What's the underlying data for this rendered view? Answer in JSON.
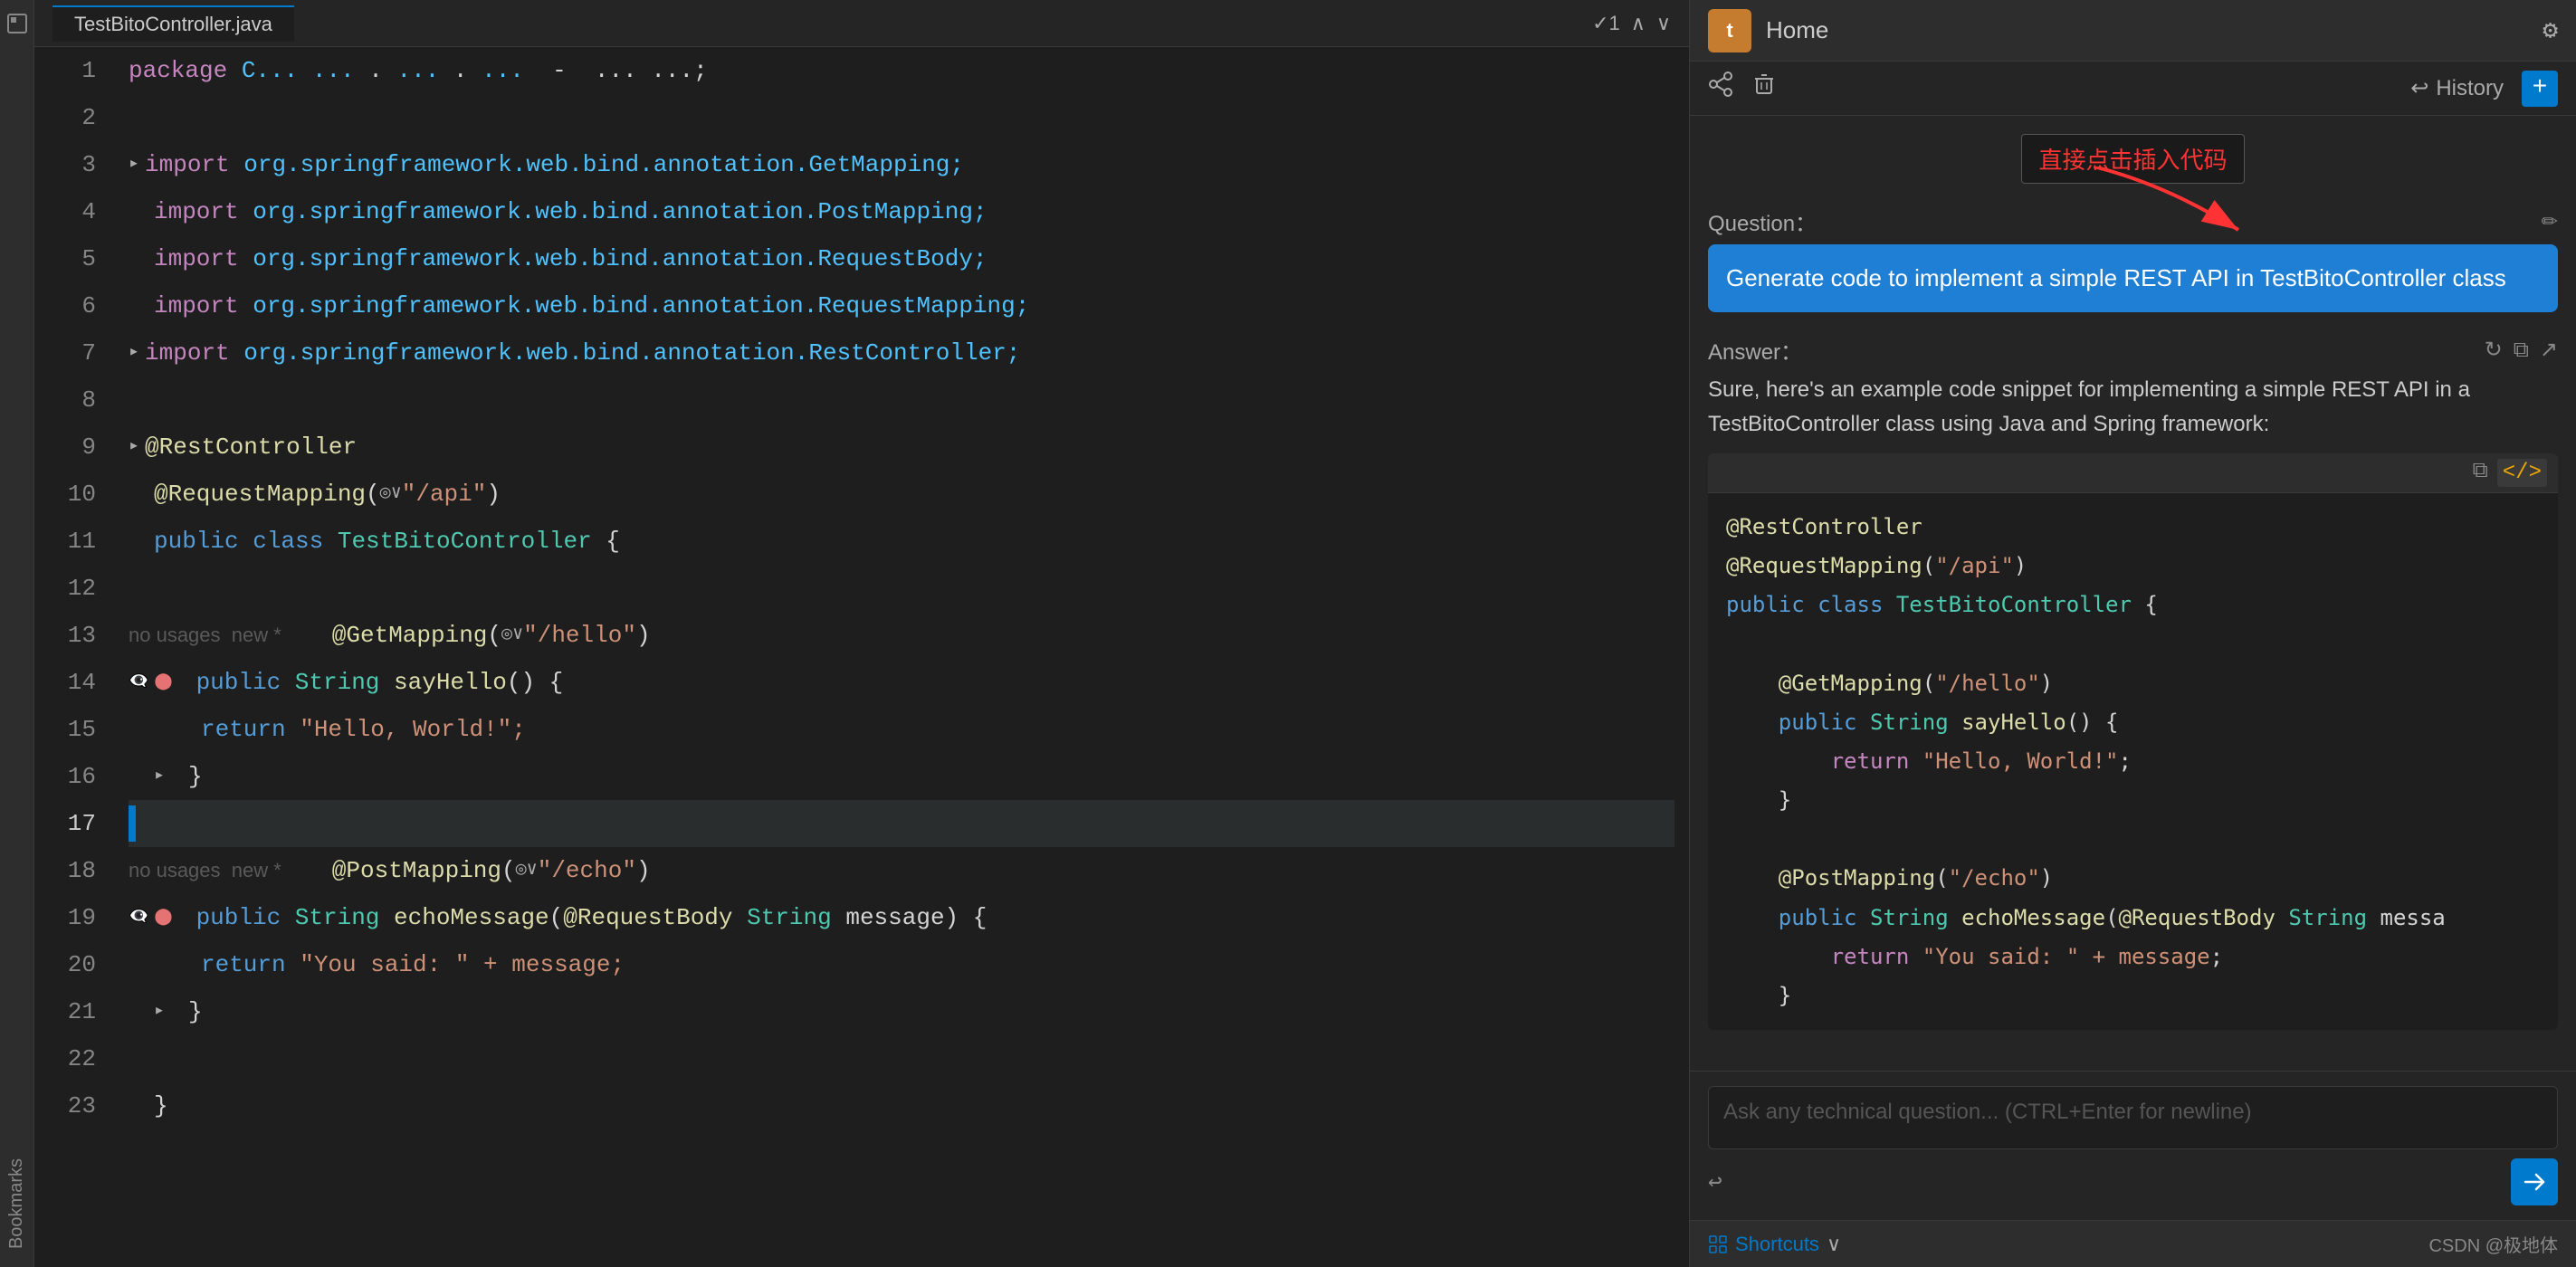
{
  "editor": {
    "tab": "TestBitoController.java",
    "lines": [
      {
        "num": 1,
        "tokens": [
          {
            "t": "package ",
            "c": "package-kw"
          },
          {
            "t": "C... ... ... ... ... ... ...;",
            "c": "text-white"
          }
        ],
        "indent": 0,
        "meta": ""
      },
      {
        "num": 2,
        "tokens": [],
        "indent": 0,
        "meta": ""
      },
      {
        "num": 3,
        "tokens": [
          {
            "t": "import ",
            "c": "kw"
          },
          {
            "t": "org.springframework.web.bind.annotation.GetMapping;",
            "c": "import-pkg"
          }
        ],
        "indent": 0,
        "meta": "",
        "fold": true
      },
      {
        "num": 4,
        "tokens": [
          {
            "t": "import ",
            "c": "kw"
          },
          {
            "t": "org.springframework.web.bind.annotation.PostMapping;",
            "c": "import-pkg"
          }
        ],
        "indent": 0,
        "meta": ""
      },
      {
        "num": 5,
        "tokens": [
          {
            "t": "import ",
            "c": "kw"
          },
          {
            "t": "org.springframework.web.bind.annotation.RequestBody;",
            "c": "import-pkg"
          }
        ],
        "indent": 0,
        "meta": ""
      },
      {
        "num": 6,
        "tokens": [
          {
            "t": "import ",
            "c": "kw"
          },
          {
            "t": "org.springframework.web.bind.annotation.RequestMapping;",
            "c": "import-pkg"
          }
        ],
        "indent": 0,
        "meta": ""
      },
      {
        "num": 7,
        "tokens": [
          {
            "t": "import ",
            "c": "kw"
          },
          {
            "t": "org.springframework.web.bind.annotation.RestController;",
            "c": "import-pkg"
          }
        ],
        "indent": 0,
        "meta": "",
        "fold": true
      },
      {
        "num": 8,
        "tokens": [],
        "indent": 0,
        "meta": ""
      },
      {
        "num": 9,
        "tokens": [
          {
            "t": "@RestController",
            "c": "annotation-name"
          }
        ],
        "indent": 0,
        "meta": "",
        "fold": true
      },
      {
        "num": 10,
        "tokens": [
          {
            "t": "@RequestMapping",
            "c": "annotation-name"
          },
          {
            "t": "(",
            "c": "text-white"
          },
          {
            "t": "◎∨\"/api\"",
            "c": "string"
          },
          {
            "t": ")",
            "c": "text-white"
          }
        ],
        "indent": 0,
        "meta": ""
      },
      {
        "num": 11,
        "tokens": [
          {
            "t": "public ",
            "c": "kw-blue"
          },
          {
            "t": "class ",
            "c": "kw-blue"
          },
          {
            "t": "TestBitoController",
            "c": "class-name"
          },
          {
            "t": " {",
            "c": "text-white"
          }
        ],
        "indent": 0,
        "meta": ""
      },
      {
        "num": 12,
        "tokens": [],
        "indent": 0,
        "meta": ""
      },
      {
        "num": 13,
        "tokens": [
          {
            "t": "@GetMapping",
            "c": "annotation-name"
          },
          {
            "t": "(",
            "c": "text-white"
          },
          {
            "t": "◎∨\"/hello\"",
            "c": "string"
          },
          {
            "t": ")",
            "c": "text-white"
          }
        ],
        "indent": 4,
        "meta": "no usages  new *",
        "fold": true
      },
      {
        "num": 14,
        "tokens": [
          {
            "t": "public ",
            "c": "kw-blue"
          },
          {
            "t": "String ",
            "c": "class-name"
          },
          {
            "t": "sayHello",
            "c": "method"
          },
          {
            "t": "() {",
            "c": "text-white"
          }
        ],
        "indent": 4,
        "meta": "",
        "icons": [
          "eye-slash",
          "circle"
        ]
      },
      {
        "num": 15,
        "tokens": [
          {
            "t": "return ",
            "c": "kw-blue"
          },
          {
            "t": "\"Hello, World!\";",
            "c": "string"
          }
        ],
        "indent": 8,
        "meta": ""
      },
      {
        "num": 16,
        "tokens": [
          {
            "t": "}",
            "c": "text-white"
          }
        ],
        "indent": 4,
        "meta": "",
        "fold_close": true
      },
      {
        "num": 17,
        "tokens": [],
        "indent": 0,
        "meta": "",
        "active": true
      },
      {
        "num": 18,
        "tokens": [
          {
            "t": "@PostMapping",
            "c": "annotation-name"
          },
          {
            "t": "(",
            "c": "text-white"
          },
          {
            "t": "◎∨\"/echo\"",
            "c": "string"
          },
          {
            "t": ")",
            "c": "text-white"
          }
        ],
        "indent": 4,
        "meta": "no usages  new *",
        "fold": true
      },
      {
        "num": 19,
        "tokens": [
          {
            "t": "public ",
            "c": "kw-blue"
          },
          {
            "t": "String ",
            "c": "class-name"
          },
          {
            "t": "echoMessage",
            "c": "method"
          },
          {
            "t": "(@RequestBody ",
            "c": "annotation-name"
          },
          {
            "t": "String",
            "c": "class-name"
          },
          {
            "t": " message) {",
            "c": "text-white"
          }
        ],
        "indent": 4,
        "meta": "",
        "icons": [
          "eye-slash",
          "circle"
        ]
      },
      {
        "num": 20,
        "tokens": [
          {
            "t": "return ",
            "c": "kw-blue"
          },
          {
            "t": "\"You said: \" + message;",
            "c": "string"
          }
        ],
        "indent": 8,
        "meta": ""
      },
      {
        "num": 21,
        "tokens": [
          {
            "t": "}",
            "c": "text-white"
          }
        ],
        "indent": 4,
        "meta": "",
        "fold_close": true
      },
      {
        "num": 22,
        "tokens": [],
        "indent": 0,
        "meta": ""
      },
      {
        "num": 23,
        "tokens": [
          {
            "t": "}",
            "c": "text-white"
          }
        ],
        "indent": 0,
        "meta": ""
      }
    ]
  },
  "panel": {
    "logo_text": "t",
    "title": "Home",
    "settings_icon": "⚙",
    "toolbar": {
      "share_icon": "↗",
      "trash_icon": "🗑",
      "history_icon": "↩",
      "history_label": "History",
      "new_icon": "+"
    },
    "tooltip": "直接点击插入代码",
    "question_label": "Question：",
    "question_text": "Generate code to implement a simple REST API in TestBitoController class",
    "edit_icon": "✏",
    "answer_label": "Answer：",
    "answer_icons": [
      "↻",
      "⧉",
      "↗"
    ],
    "answer_text": "Sure, here's an example code snippet for implementing a simple REST API in a TestBitoController class using Java and Spring framework:",
    "code_copy_icon": "⧉",
    "code_embed_icon": "</>",
    "code_lines": [
      {
        "text": "@RestController",
        "class": "cb-annotation"
      },
      {
        "text": "@RequestMapping(\"/api\")",
        "class": "cb-annotation"
      },
      {
        "text": "public class TestBitoController {",
        "tokens": [
          {
            "t": "public ",
            "c": "cb-kw"
          },
          {
            "t": "class ",
            "c": "cb-kw"
          },
          {
            "t": "TestBitoController",
            "c": "cb-class"
          },
          {
            "t": " {",
            "c": "cb-white"
          }
        ]
      },
      {
        "text": ""
      },
      {
        "text": "    @GetMapping(\"/hello\")",
        "class": "cb-annotation"
      },
      {
        "text": "    public String sayHello() {",
        "tokens": [
          {
            "t": "    public ",
            "c": "cb-kw"
          },
          {
            "t": "String",
            "c": "cb-class"
          },
          {
            "t": " sayHello() {",
            "c": "cb-white"
          }
        ]
      },
      {
        "text": "        return \"Hello, World!\";",
        "tokens": [
          {
            "t": "        return ",
            "c": "cb-return"
          },
          {
            "t": "\"Hello, World!\";",
            "c": "cb-string"
          }
        ]
      },
      {
        "text": "    }"
      },
      {
        "text": ""
      },
      {
        "text": "    @PostMapping(\"/echo\")",
        "class": "cb-annotation"
      },
      {
        "text": "    public String echoMessage(@RequestBody String messa",
        "tokens": [
          {
            "t": "    public ",
            "c": "cb-kw"
          },
          {
            "t": "String",
            "c": "cb-class"
          },
          {
            "t": " echoMessage(@RequestBody ",
            "c": "cb-annotation"
          },
          {
            "t": "String",
            "c": "cb-class"
          },
          {
            "t": " messa",
            "c": "cb-white"
          }
        ]
      },
      {
        "text": "        return \"You said: \" + message;",
        "tokens": [
          {
            "t": "        return ",
            "c": "cb-return"
          },
          {
            "t": "\"You said: \" + message;",
            "c": "cb-string"
          }
        ]
      },
      {
        "text": "    }"
      }
    ],
    "input_placeholder": "Ask any technical question... (CTRL+Enter for newline)",
    "shortcuts_label": "Shortcuts",
    "shortcuts_chevron": "∨",
    "csdn_label": "CSDN @极地体"
  }
}
